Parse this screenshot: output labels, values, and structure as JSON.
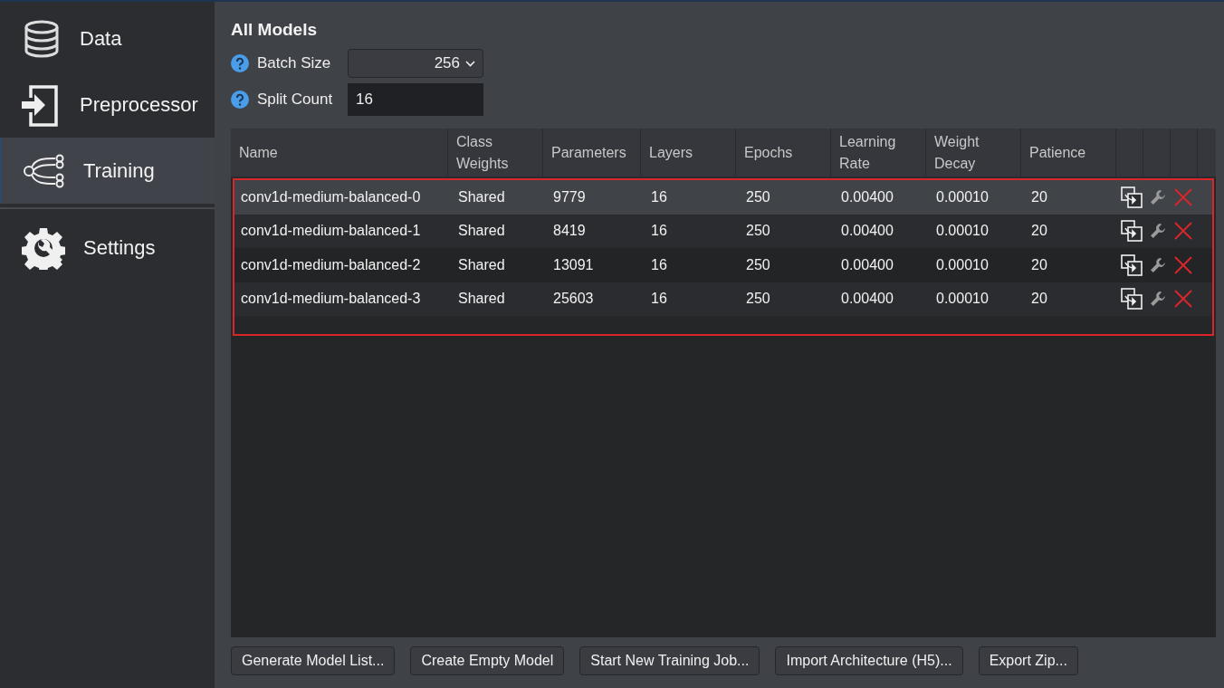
{
  "sidebar": {
    "items": [
      {
        "label": "Data",
        "kind": "database",
        "selected": false
      },
      {
        "label": "Preprocessor",
        "kind": "import",
        "selected": false
      },
      {
        "label": "Training",
        "kind": "network",
        "selected": true
      },
      {
        "label": "Settings",
        "kind": "settings",
        "selected": false
      }
    ]
  },
  "title": "All Models",
  "fields": [
    {
      "label": "Batch Size",
      "kind": "dropdown",
      "value": "256"
    },
    {
      "label": "Split Count",
      "kind": "text",
      "value": "16"
    }
  ],
  "table": {
    "columns": [
      "Name",
      "Class Weights",
      "Parameters",
      "Layers",
      "Epochs",
      "Learning Rate",
      "Weight Decay",
      "Patience"
    ],
    "rows": [
      {
        "cells": [
          "conv1d-medium-balanced-0",
          "Shared",
          "9779",
          "16",
          "250",
          "0.00400",
          "0.00010",
          "20"
        ],
        "selected": true
      },
      {
        "cells": [
          "conv1d-medium-balanced-1",
          "Shared",
          "8419",
          "16",
          "250",
          "0.00400",
          "0.00010",
          "20"
        ],
        "selected": false
      },
      {
        "cells": [
          "conv1d-medium-balanced-2",
          "Shared",
          "13091",
          "16",
          "250",
          "0.00400",
          "0.00010",
          "20"
        ],
        "selected": false
      },
      {
        "cells": [
          "conv1d-medium-balanced-3",
          "Shared",
          "25603",
          "16",
          "250",
          "0.00400",
          "0.00010",
          "20"
        ],
        "selected": false
      }
    ]
  },
  "buttons": [
    "Generate Model List...",
    "Create Empty Model",
    "Start New Training Job...",
    "Import Architecture (H5)...",
    "Export Zip..."
  ]
}
